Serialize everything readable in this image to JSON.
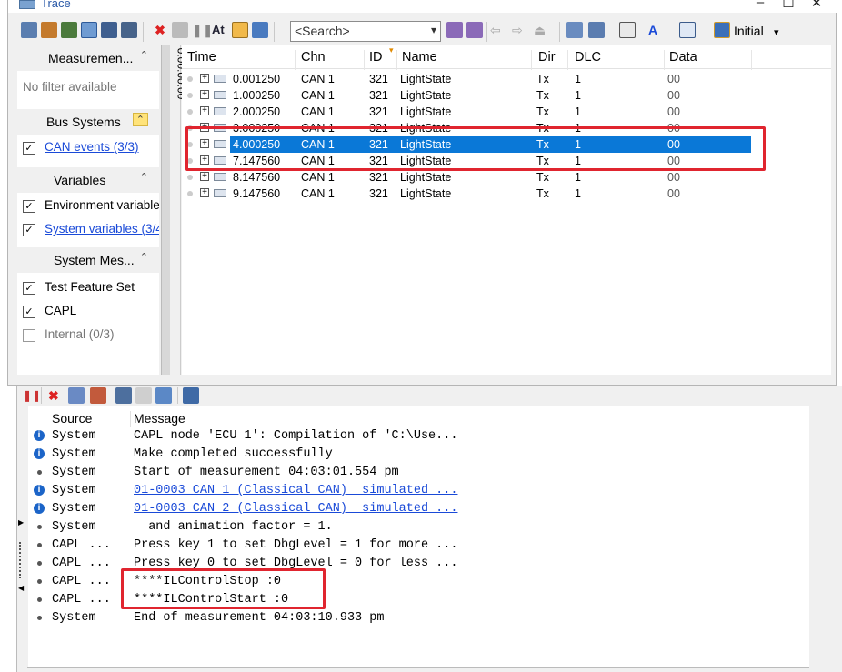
{
  "trace": {
    "title": "Trace",
    "search_placeholder": "<Search>",
    "initial_label": "Initial",
    "time_bar_label": "0:00:00:00",
    "filters": {
      "measurement": {
        "label": "Measuremen...",
        "empty": "No filter available"
      },
      "bus_systems": {
        "label": "Bus Systems",
        "items": [
          {
            "label": "CAN events (3/3)",
            "checked": true
          }
        ]
      },
      "variables": {
        "label": "Variables",
        "items": [
          {
            "label": "Environment variable",
            "checked": true
          },
          {
            "label": "System variables (3/4",
            "checked": true
          }
        ]
      },
      "system_messages": {
        "label": "System Mes...",
        "items": [
          {
            "label": "Test Feature Set",
            "checked": true
          },
          {
            "label": "CAPL",
            "checked": true
          },
          {
            "label": "Internal (0/3)",
            "checked": false
          }
        ]
      }
    },
    "columns": [
      "Time",
      "Chn",
      "ID",
      "Name",
      "Dir",
      "DLC",
      "Data"
    ],
    "rows": [
      {
        "time": "0.001250",
        "chn": "CAN 1",
        "id": "321",
        "name": "LightState",
        "dir": "Tx",
        "dlc": "1",
        "data": "00"
      },
      {
        "time": "1.000250",
        "chn": "CAN 1",
        "id": "321",
        "name": "LightState",
        "dir": "Tx",
        "dlc": "1",
        "data": "00"
      },
      {
        "time": "2.000250",
        "chn": "CAN 1",
        "id": "321",
        "name": "LightState",
        "dir": "Tx",
        "dlc": "1",
        "data": "00"
      },
      {
        "time": "3.000250",
        "chn": "CAN 1",
        "id": "321",
        "name": "LightState",
        "dir": "Tx",
        "dlc": "1",
        "data": "00"
      },
      {
        "time": "4.000250",
        "chn": "CAN 1",
        "id": "321",
        "name": "LightState",
        "dir": "Tx",
        "dlc": "1",
        "data": "00",
        "selected": true
      },
      {
        "time": "7.147560",
        "chn": "CAN 1",
        "id": "321",
        "name": "LightState",
        "dir": "Tx",
        "dlc": "1",
        "data": "00"
      },
      {
        "time": "8.147560",
        "chn": "CAN 1",
        "id": "321",
        "name": "LightState",
        "dir": "Tx",
        "dlc": "1",
        "data": "00"
      },
      {
        "time": "9.147560",
        "chn": "CAN 1",
        "id": "321",
        "name": "LightState",
        "dir": "Tx",
        "dlc": "1",
        "data": "00"
      }
    ]
  },
  "write": {
    "columns": [
      "Source",
      "Message"
    ],
    "rows": [
      {
        "icon": "info-icon",
        "source": "System",
        "message": "CAPL node 'ECU 1': Compilation of 'C:\\Use..."
      },
      {
        "icon": "info-icon",
        "source": "System",
        "message": "Make completed successfully"
      },
      {
        "icon": "bullet",
        "source": "System",
        "message": "Start of measurement 04:03:01.554 pm"
      },
      {
        "icon": "info-icon",
        "source": "System",
        "message": "01-0003 CAN 1 (Classical CAN)  simulated ...",
        "link": true
      },
      {
        "icon": "info-icon",
        "source": "System",
        "message": "01-0003 CAN 2 (Classical CAN)  simulated ...",
        "link": true
      },
      {
        "icon": "bullet",
        "source": "System",
        "message": "  and animation factor = 1."
      },
      {
        "icon": "bullet",
        "source": "CAPL ...",
        "message": "Press key 1 to set DbgLevel = 1 for more ..."
      },
      {
        "icon": "bullet",
        "source": "CAPL ...",
        "message": "Press key 0 to set DbgLevel = 0 for less ..."
      },
      {
        "icon": "bullet",
        "source": "CAPL ...",
        "message": "****ILControlStop :0"
      },
      {
        "icon": "bullet",
        "source": "CAPL ...",
        "message": "****ILControlStart :0"
      },
      {
        "icon": "bullet",
        "source": "System",
        "message": "End of measurement 04:03:10.933 pm"
      }
    ]
  },
  "colors": {
    "selection": "#0a78d7",
    "highlight_box": "#e0252f",
    "link": "#1a4ad8"
  }
}
